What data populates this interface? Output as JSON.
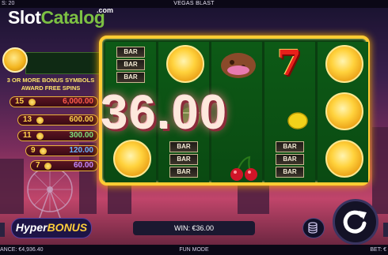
{
  "topbar": {
    "spins_label": "S: 20",
    "title": "VEGAS BLAST"
  },
  "watermark": {
    "part1": "Slot",
    "part2": "Catalog",
    "tld": ".com"
  },
  "bonus_panel": {
    "line1": "3 OR MORE BONUS SYMBOLS",
    "line2": "AWARD FREE SPINS",
    "rows": [
      {
        "count": "15",
        "value": "6,000.00"
      },
      {
        "count": "13",
        "value": "600.00"
      },
      {
        "count": "11",
        "value": "300.00"
      },
      {
        "count": "9",
        "value": "120.00"
      },
      {
        "count": "7",
        "value": "60.00"
      }
    ]
  },
  "reels": {
    "bar_label": "BAR",
    "columns": [
      [
        "bar",
        "cookie",
        "coin"
      ],
      [
        "coin",
        "watermelon",
        "bar"
      ],
      [
        "cookie",
        "bar",
        "cherry"
      ],
      [
        "seven",
        "lemon",
        "bar"
      ],
      [
        "coin",
        "coin",
        "coin"
      ]
    ]
  },
  "big_win": "36.00",
  "hyper_bonus": {
    "part1": "Hyper",
    "part2": "BONUS"
  },
  "win_display": "WIN: €36.00",
  "bottombar": {
    "balance": "ANCE: €4,936.40",
    "mode": "FUN MODE",
    "bet": "BET: €"
  },
  "icons": {
    "spin": "spin-arrow-icon",
    "stack": "coin-stack-icon"
  },
  "colors": {
    "frame": "#ffcc33",
    "reel_bg": "#0a4a12",
    "win_text": "#fde8dc",
    "bonus_yellow": "#ffe46a"
  }
}
